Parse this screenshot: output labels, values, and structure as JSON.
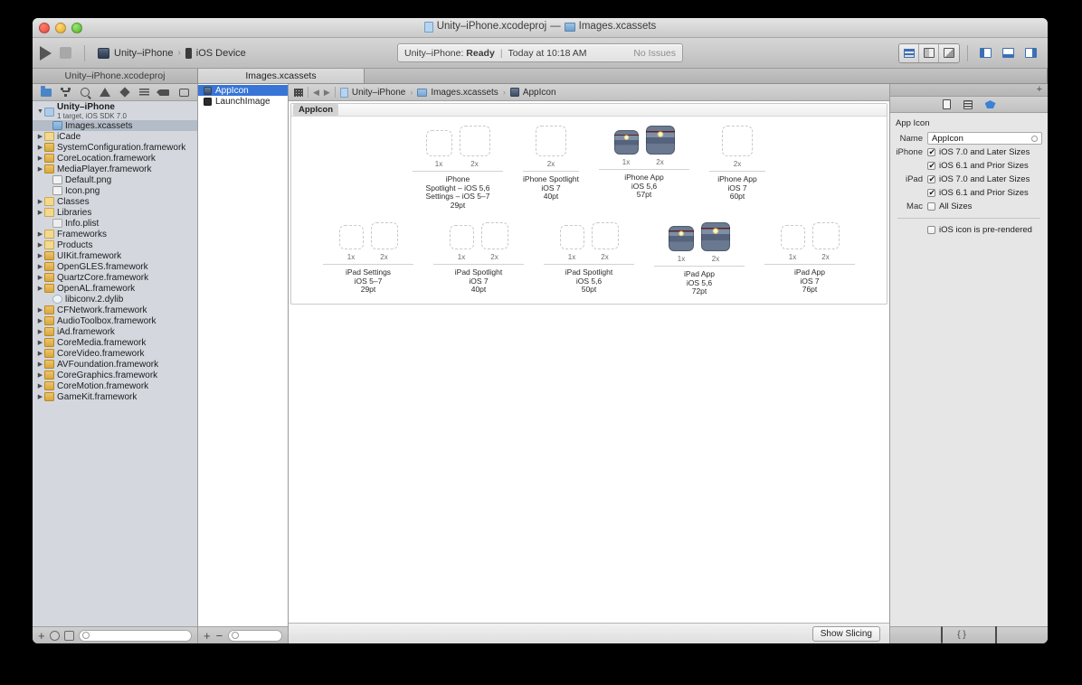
{
  "window": {
    "title": "Unity–iPhone.xcodeproj — Images.xcassets",
    "title_project": "Unity–iPhone.xcodeproj",
    "title_dash": "—",
    "title_file": "Images.xcassets"
  },
  "toolbar": {
    "run_label": "Run",
    "stop_label": "Stop",
    "scheme_name": "Unity–iPhone",
    "scheme_sep": "›",
    "destination": "iOS Device",
    "status": {
      "prefix": "Unity–iPhone:",
      "state": "Ready",
      "divider": "|",
      "time": "Today at 10:18 AM",
      "issues": "No Issues"
    },
    "editor_modes": [
      "standard-editor",
      "assistant-editor",
      "version-editor"
    ],
    "view_toggles": [
      "navigator-toggle",
      "debug-area-toggle",
      "utilities-toggle"
    ]
  },
  "tabs": [
    {
      "label": "Unity–iPhone.xcodeproj",
      "active": false
    },
    {
      "label": "Images.xcassets",
      "active": true
    },
    {
      "label": "",
      "active": false
    }
  ],
  "navigator": {
    "toolbar_icons": [
      "folder-icon",
      "branch-icon",
      "search-icon",
      "warning-icon",
      "diamond-icon",
      "list-icon",
      "tag-icon",
      "comment-icon"
    ],
    "project": {
      "name": "Unity–iPhone",
      "subtitle": "1 target, iOS SDK 7.0"
    },
    "items": [
      {
        "label": "Images.xcassets",
        "icon": "cassets",
        "disclosure": "none",
        "indent": 2,
        "selected": true
      },
      {
        "label": "iCade",
        "icon": "folder",
        "disclosure": "closed",
        "indent": 1,
        "selected": false
      },
      {
        "label": "SystemConfiguration.framework",
        "icon": "fw",
        "disclosure": "closed",
        "indent": 1,
        "selected": false
      },
      {
        "label": "CoreLocation.framework",
        "icon": "fw",
        "disclosure": "closed",
        "indent": 1,
        "selected": false
      },
      {
        "label": "MediaPlayer.framework",
        "icon": "fw",
        "disclosure": "closed",
        "indent": 1,
        "selected": false
      },
      {
        "label": "Default.png",
        "icon": "png",
        "disclosure": "none",
        "indent": 2,
        "selected": false
      },
      {
        "label": "Icon.png",
        "icon": "png",
        "disclosure": "none",
        "indent": 2,
        "selected": false
      },
      {
        "label": "Classes",
        "icon": "folder",
        "disclosure": "closed",
        "indent": 1,
        "selected": false
      },
      {
        "label": "Libraries",
        "icon": "folder",
        "disclosure": "closed",
        "indent": 1,
        "selected": false
      },
      {
        "label": "Info.plist",
        "icon": "plist",
        "disclosure": "none",
        "indent": 2,
        "selected": false
      },
      {
        "label": "Frameworks",
        "icon": "folder",
        "disclosure": "closed",
        "indent": 1,
        "selected": false
      },
      {
        "label": "Products",
        "icon": "folder",
        "disclosure": "closed",
        "indent": 1,
        "selected": false
      },
      {
        "label": "UIKit.framework",
        "icon": "fw",
        "disclosure": "closed",
        "indent": 1,
        "selected": false
      },
      {
        "label": "OpenGLES.framework",
        "icon": "fw",
        "disclosure": "closed",
        "indent": 1,
        "selected": false
      },
      {
        "label": "QuartzCore.framework",
        "icon": "fw",
        "disclosure": "closed",
        "indent": 1,
        "selected": false
      },
      {
        "label": "OpenAL.framework",
        "icon": "fw",
        "disclosure": "closed",
        "indent": 1,
        "selected": false
      },
      {
        "label": "libiconv.2.dylib",
        "icon": "dylib",
        "disclosure": "none",
        "indent": 2,
        "selected": false
      },
      {
        "label": "CFNetwork.framework",
        "icon": "fw",
        "disclosure": "closed",
        "indent": 1,
        "selected": false
      },
      {
        "label": "AudioToolbox.framework",
        "icon": "fw",
        "disclosure": "closed",
        "indent": 1,
        "selected": false
      },
      {
        "label": "iAd.framework",
        "icon": "fw",
        "disclosure": "closed",
        "indent": 1,
        "selected": false
      },
      {
        "label": "CoreMedia.framework",
        "icon": "fw",
        "disclosure": "closed",
        "indent": 1,
        "selected": false
      },
      {
        "label": "CoreVideo.framework",
        "icon": "fw",
        "disclosure": "closed",
        "indent": 1,
        "selected": false
      },
      {
        "label": "AVFoundation.framework",
        "icon": "fw",
        "disclosure": "closed",
        "indent": 1,
        "selected": false
      },
      {
        "label": "CoreGraphics.framework",
        "icon": "fw",
        "disclosure": "closed",
        "indent": 1,
        "selected": false
      },
      {
        "label": "CoreMotion.framework",
        "icon": "fw",
        "disclosure": "closed",
        "indent": 1,
        "selected": false
      },
      {
        "label": "GameKit.framework",
        "icon": "fw",
        "disclosure": "closed",
        "indent": 1,
        "selected": false
      }
    ],
    "bottom": {
      "add_label": "+",
      "filter_placeholder": ""
    }
  },
  "asset_list": {
    "items": [
      {
        "label": "AppIcon",
        "selected": true
      },
      {
        "label": "LaunchImage",
        "selected": false
      }
    ],
    "bottom": {
      "add_label": "+",
      "remove_label": "−",
      "filter_placeholder": ""
    }
  },
  "jumpbar": {
    "crumbs": [
      "Unity–iPhone",
      "Images.xcassets",
      "AppIcon"
    ],
    "separator": "›",
    "back": "◀",
    "forward": "▶"
  },
  "editor": {
    "set_title": "AppIcon",
    "show_slicing_label": "Show Slicing",
    "groups": [
      {
        "row": 1,
        "caption": [
          "iPhone",
          "Spotlight – iOS 5,6",
          "Settings – iOS 5–7",
          "29pt"
        ],
        "slots": [
          {
            "scale": "1x",
            "size": 29,
            "filled": false
          },
          {
            "scale": "2x",
            "size": 34,
            "filled": false
          }
        ]
      },
      {
        "row": 1,
        "caption": [
          "iPhone Spotlight",
          "iOS 7",
          "40pt"
        ],
        "slots": [
          {
            "scale": "2x",
            "size": 34,
            "filled": false
          }
        ]
      },
      {
        "row": 1,
        "caption": [
          "iPhone App",
          "iOS 5,6",
          "57pt"
        ],
        "slots": [
          {
            "scale": "1x",
            "size": 27,
            "filled": true
          },
          {
            "scale": "2x",
            "size": 32,
            "filled": true
          }
        ]
      },
      {
        "row": 1,
        "caption": [
          "iPhone App",
          "iOS 7",
          "60pt"
        ],
        "slots": [
          {
            "scale": "2x",
            "size": 34,
            "filled": false
          }
        ]
      },
      {
        "row": 2,
        "caption": [
          "iPad Settings",
          "iOS 5–7",
          "29pt"
        ],
        "slots": [
          {
            "scale": "1x",
            "size": 27,
            "filled": false
          },
          {
            "scale": "2x",
            "size": 30,
            "filled": false
          }
        ]
      },
      {
        "row": 2,
        "caption": [
          "iPad Spotlight",
          "iOS 7",
          "40pt"
        ],
        "slots": [
          {
            "scale": "1x",
            "size": 27,
            "filled": false
          },
          {
            "scale": "2x",
            "size": 30,
            "filled": false
          }
        ]
      },
      {
        "row": 2,
        "caption": [
          "iPad Spotlight",
          "iOS 5,6",
          "50pt"
        ],
        "slots": [
          {
            "scale": "1x",
            "size": 27,
            "filled": false
          },
          {
            "scale": "2x",
            "size": 30,
            "filled": false
          }
        ]
      },
      {
        "row": 2,
        "caption": [
          "iPad App",
          "iOS 5,6",
          "72pt"
        ],
        "slots": [
          {
            "scale": "1x",
            "size": 28,
            "filled": true
          },
          {
            "scale": "2x",
            "size": 32,
            "filled": true
          }
        ]
      },
      {
        "row": 2,
        "caption": [
          "iPad App",
          "iOS 7",
          "76pt"
        ],
        "slots": [
          {
            "scale": "1x",
            "size": 27,
            "filled": false
          },
          {
            "scale": "2x",
            "size": 30,
            "filled": false
          }
        ]
      }
    ]
  },
  "inspector": {
    "tabs": [
      "file-inspector-icon",
      "quick-help-icon",
      "attributes-inspector-icon"
    ],
    "section_title": "App Icon",
    "name_label": "Name",
    "name_value": "AppIcon",
    "rows": [
      {
        "label": "iPhone",
        "text": "iOS 7.0 and Later Sizes",
        "checked": true
      },
      {
        "label": "",
        "text": "iOS 6.1 and Prior Sizes",
        "checked": true
      },
      {
        "label": "iPad",
        "text": "iOS 7.0 and Later Sizes",
        "checked": true
      },
      {
        "label": "",
        "text": "iOS 6.1 and Prior Sizes",
        "checked": true
      },
      {
        "label": "Mac",
        "text": "All Sizes",
        "checked": false
      }
    ],
    "prerendered": {
      "text": "iOS icon is pre-rendered",
      "checked": false
    },
    "bottom_icons": [
      "file-template-library-icon",
      "code-snippet-library-icon",
      "object-library-icon",
      "media-library-icon"
    ]
  },
  "colors": {
    "selection_blue": "#3875d7",
    "accent_blue": "#3b82d6",
    "window_chrome": "#d8d8d8"
  }
}
